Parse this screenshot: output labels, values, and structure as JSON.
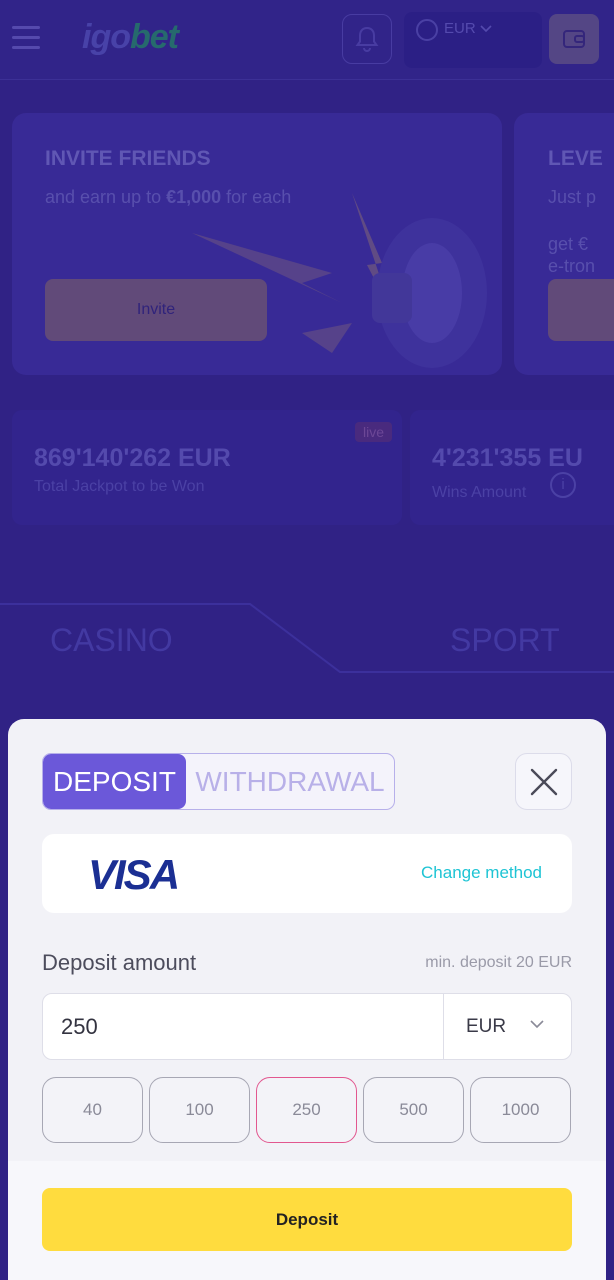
{
  "header": {
    "logo_main": "igo",
    "logo_accent": "bet",
    "currency": "EUR"
  },
  "promos": [
    {
      "title": "INVITE FRIENDS",
      "text_prefix": "and earn up to ",
      "text_bold": "€1,000",
      "text_suffix": " for each",
      "button": "Invite"
    },
    {
      "title": "LEVE",
      "text": "Just p",
      "text2_line1": "get €",
      "text2_line2": "e-tron"
    }
  ],
  "jackpots": [
    {
      "amount": "869'140'262 EUR",
      "label": "Total Jackpot to be Won",
      "badge": "live"
    },
    {
      "amount": "4'231'355 EU",
      "label": "Wins Amount"
    }
  ],
  "nav": {
    "casino": "CASINO",
    "sport": "SPORT"
  },
  "modal": {
    "tab_deposit": "DEPOSIT",
    "tab_withdrawal": "WITHDRAWAL",
    "method_logo": "VISA",
    "change_method": "Change method",
    "amount_label": "Deposit amount",
    "min_deposit": "min. deposit 20 EUR",
    "amount_value": "250",
    "currency": "EUR",
    "presets": [
      "40",
      "100",
      "250",
      "500",
      "1000"
    ],
    "active_preset": "250",
    "deposit_button": "Deposit"
  },
  "colors": {
    "accent": "#6b58d9",
    "deposit_button": "#ffdc3e",
    "change_method": "#1ec4d4",
    "active_preset_border": "#e2578f",
    "visa": "#1b2f93"
  }
}
